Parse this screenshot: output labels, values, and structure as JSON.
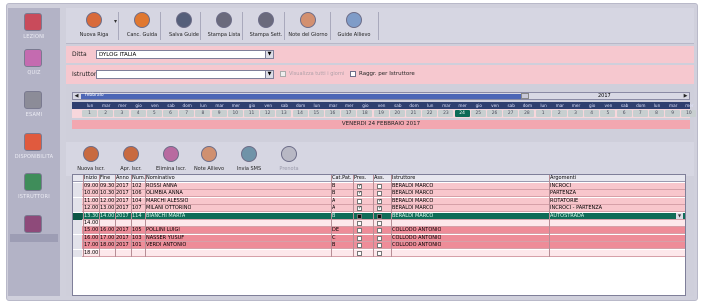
{
  "sidebar": {
    "items": [
      {
        "label": "LEZIONI",
        "icon": "book-icon",
        "color": "#c94b5b"
      },
      {
        "label": "QUIZ",
        "icon": "quiz-icon",
        "color": "#c46bb0"
      },
      {
        "label": "ESAMI",
        "icon": "exam-icon",
        "color": "#8c8c98"
      },
      {
        "label": "DISPONIBILITA",
        "icon": "availability-icon",
        "color": "#e05a3e"
      },
      {
        "label": "ISTRUTTORI",
        "icon": "instructor-icon",
        "color": "#3f8d5a"
      },
      {
        "label": "GUIDE",
        "icon": "guide-icon",
        "color": "#8e4a7a"
      }
    ]
  },
  "toolbar": {
    "buttons": [
      {
        "label": "Nuova Riga",
        "icon": "new-row-icon"
      },
      {
        "label": "Canc. Guida",
        "icon": "delete-guide-icon"
      },
      {
        "label": "Salva Guide",
        "icon": "save-icon"
      },
      {
        "label": "Stampa Lista",
        "icon": "print-list-icon"
      },
      {
        "label": "Stampa Sett.",
        "icon": "print-week-icon"
      },
      {
        "label": "Note del Giorno",
        "icon": "day-notes-icon"
      },
      {
        "label": "Guide Allievo",
        "icon": "student-guides-icon"
      }
    ]
  },
  "filters": {
    "ditta_label": "Ditta",
    "ditta_value": "DYLOG ITALIA",
    "istruttore_label": "Istruttore",
    "istruttore_value": "",
    "check1_label": "Visualizza tutti i giorni",
    "check2_label": "Raggr. per Istruttore"
  },
  "calendar": {
    "scroll_left_label": "febbraio",
    "scroll_right_label": "2017",
    "day_names": [
      "lun",
      "mar",
      "mer",
      "gio",
      "ven",
      "sab",
      "dom",
      "lun",
      "mar",
      "mer",
      "gio",
      "ven",
      "sab",
      "dom",
      "lun",
      "mar",
      "mer",
      "gio",
      "ven",
      "sab",
      "dom",
      "lun",
      "mar",
      "mer",
      "gio",
      "ven",
      "sab",
      "dom",
      "lun",
      "mar",
      "mer",
      "gio",
      "ven",
      "sab",
      "dom",
      "lun",
      "mar",
      "mer"
    ],
    "day_numbers": [
      "1",
      "2",
      "3",
      "4",
      "5",
      "6",
      "7",
      "8",
      "9",
      "10",
      "11",
      "12",
      "13",
      "14",
      "15",
      "16",
      "17",
      "18",
      "19",
      "20",
      "21",
      "22",
      "23",
      "24",
      "25",
      "26",
      "27",
      "28",
      "1",
      "2",
      "3",
      "4",
      "5",
      "6",
      "7",
      "8",
      "9",
      "10"
    ],
    "selected_index": 23,
    "date_text": "VENERDI 24 FEBBRAIO 2017"
  },
  "toolbar2": {
    "buttons": [
      {
        "label": "Nuova Iscr.",
        "icon": "new-enroll-icon"
      },
      {
        "label": "Apr. Iscr.",
        "icon": "open-enroll-icon"
      },
      {
        "label": "Elimina Iscr.",
        "icon": "delete-enroll-icon"
      },
      {
        "label": "Note Allievo",
        "icon": "student-notes-icon"
      },
      {
        "label": "Invia SMS",
        "icon": "sms-icon"
      },
      {
        "label": "Prenota",
        "icon": "book-slot-icon"
      }
    ]
  },
  "grid": {
    "headers": [
      "Inizio",
      "Fine",
      "Anno",
      "Num.",
      "Nominativo",
      "Cat.Pat.",
      "Pres.",
      "Ass.",
      "Istruttore",
      "Argomenti"
    ],
    "rows": [
      {
        "cls": "pink",
        "inizio": "09.00",
        "fine": "09.30",
        "anno": "2017",
        "num": "102",
        "nome": "ROSSI ANNA",
        "cat": "B",
        "pres": "on",
        "ass": "",
        "istr": "BERALDI MARCO",
        "arg": "INCROCI"
      },
      {
        "cls": "pink",
        "inizio": "10.00",
        "fine": "10.30",
        "anno": "2017",
        "num": "106",
        "nome": "OLIMBIA ANNA",
        "cat": "B",
        "pres": "on",
        "ass": "",
        "istr": "BERALDI MARCO",
        "arg": "PARTENZA"
      },
      {
        "cls": "pink",
        "inizio": "11.00",
        "fine": "12.00",
        "anno": "2017",
        "num": "104",
        "nome": "MARCHI ALESSIO",
        "cat": "A",
        "pres": "",
        "ass": "on",
        "istr": "BERALDI MARCO",
        "arg": "ROTATORIE"
      },
      {
        "cls": "pink",
        "inizio": "12.00",
        "fine": "13.00",
        "anno": "2017",
        "num": "107",
        "nome": "MILANI OTTORINO",
        "cat": "A",
        "pres": "on",
        "ass": "on",
        "istr": "BERALDI MARCO",
        "arg": "INCROCI - PARTENZA"
      },
      {
        "cls": "sel",
        "inizio": "13.30",
        "fine": "14.00",
        "anno": "2017",
        "num": "114",
        "nome": "BIANCHI MARTA",
        "cat": "B",
        "pres": "blk",
        "ass": "blk",
        "istr": "BERALDI MARCO",
        "arg": "AUTOSTRADA"
      },
      {
        "cls": "blank",
        "inizio": "14.00",
        "fine": "",
        "anno": "",
        "num": "",
        "nome": "",
        "cat": "",
        "pres": "",
        "ass": "",
        "istr": "",
        "arg": ""
      },
      {
        "cls": "red",
        "inizio": "15.00",
        "fine": "16.00",
        "anno": "2017",
        "num": "105",
        "nome": "POLLINI LUIGI",
        "cat": "DE",
        "pres": "",
        "ass": "",
        "istr": "COLLODO ANTONIO",
        "arg": ""
      },
      {
        "cls": "red",
        "inizio": "16.00",
        "fine": "17.00",
        "anno": "2017",
        "num": "103",
        "nome": "NASSER YUSUF",
        "cat": "C",
        "pres": "",
        "ass": "",
        "istr": "COLLODO ANTONIO",
        "arg": ""
      },
      {
        "cls": "red",
        "inizio": "17.00",
        "fine": "18.00",
        "anno": "2017",
        "num": "101",
        "nome": "VERDI ANTONIO",
        "cat": "B",
        "pres": "",
        "ass": "",
        "istr": "COLLODO ANTONIO",
        "arg": ""
      },
      {
        "cls": "blank",
        "inizio": "18.00",
        "fine": "",
        "anno": "",
        "num": "",
        "nome": "",
        "cat": "",
        "pres": "",
        "ass": "",
        "istr": "",
        "arg": ""
      }
    ]
  }
}
